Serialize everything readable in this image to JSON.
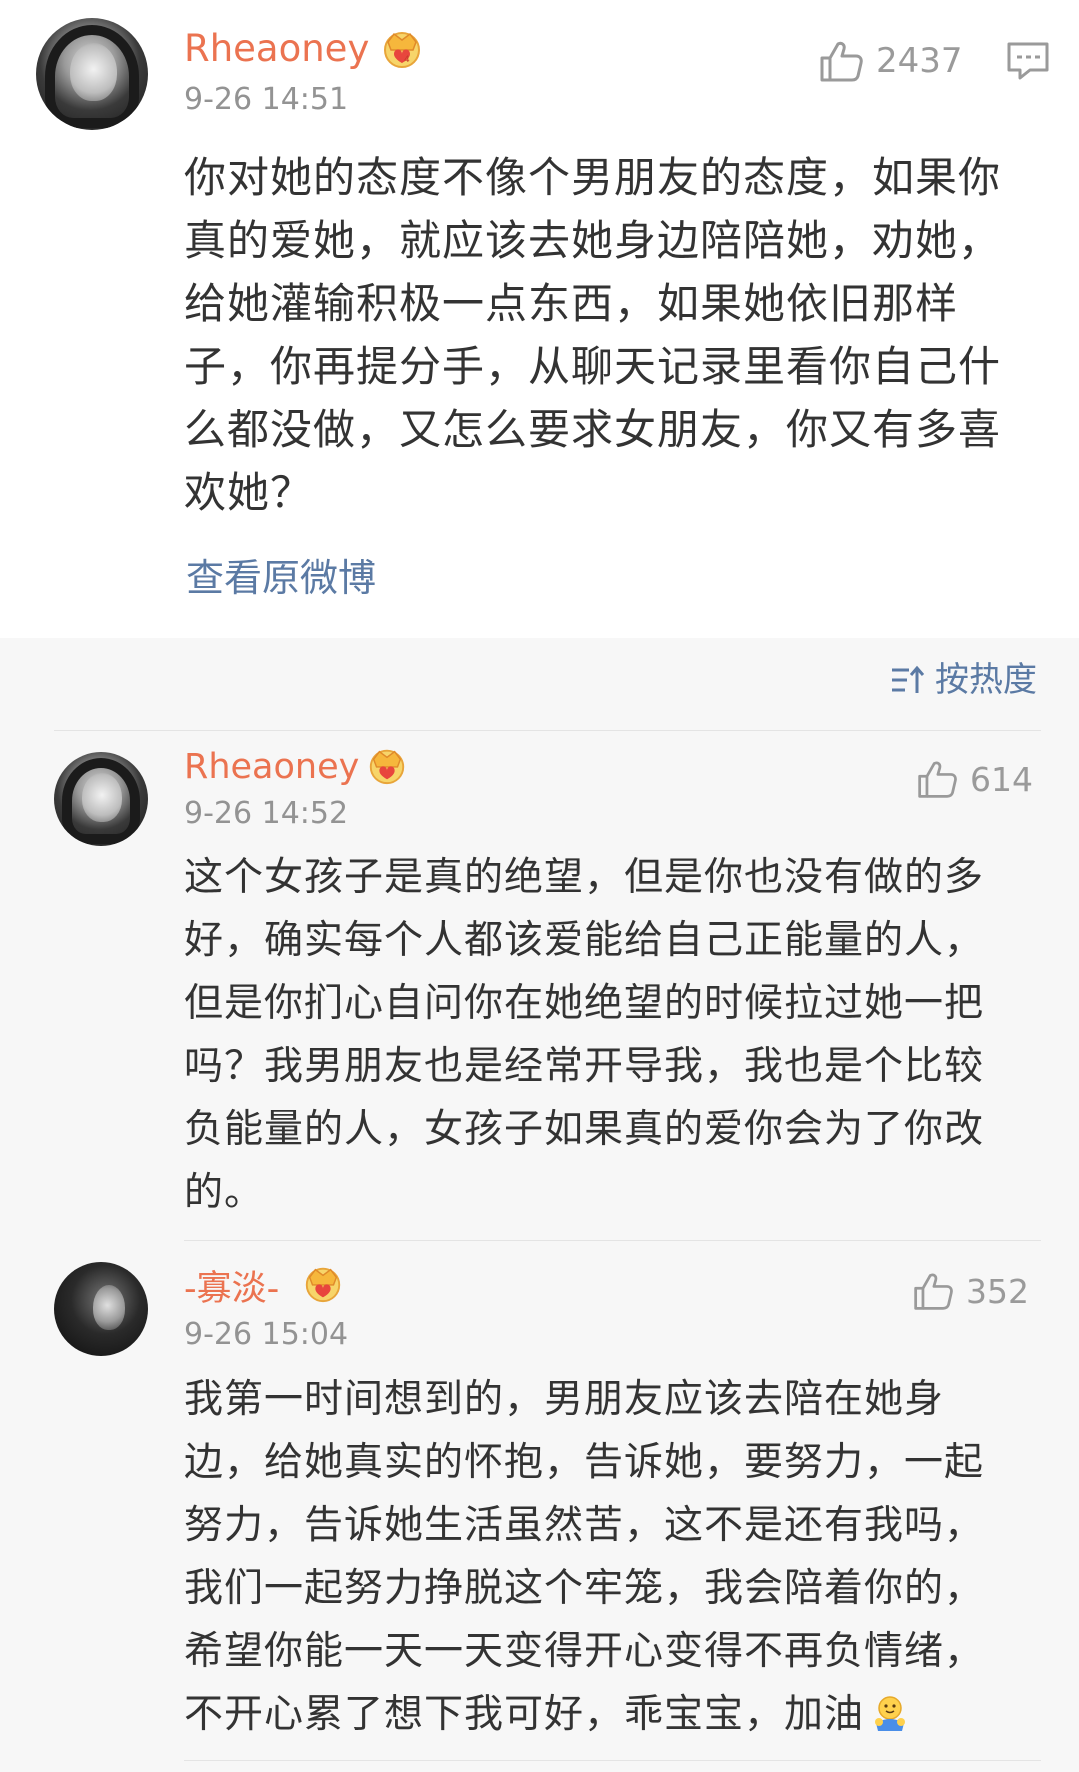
{
  "main_comment": {
    "username": "Rheaoney",
    "time": "9-26 14:51",
    "likes": "2437",
    "lines": [
      "你对她的态度不像个男朋友的态度，如果你",
      "真的爱她，就应该去她身边陪陪她，劝她，",
      "给她灌输积极一点东西，如果她依旧那样",
      "子，你再提分手，从聊天记录里看你自己什",
      "么都没做，又怎么要求女朋友，你又有多喜",
      "欢她？"
    ],
    "view_original": "查看原微博"
  },
  "sort": {
    "label": "按热度"
  },
  "replies": [
    {
      "username": "Rheaoney",
      "time": "9-26 14:52",
      "likes": "614",
      "lines": [
        "这个女孩子是真的绝望，但是你也没有做的多",
        "好，确实每个人都该爱能给自己正能量的人，",
        "但是你扪心自问你在她绝望的时候拉过她一把",
        "吗？我男朋友也是经常开导我，我也是个比较",
        "负能量的人，女孩子如果真的爱你会为了你改",
        "的。"
      ]
    },
    {
      "username": "-寡淡-",
      "time": "9-26 15:04",
      "likes": "352",
      "lines": [
        "我第一时间想到的，男朋友应该去陪在她身",
        "边，给她真实的怀抱，告诉她，要努力，一起",
        "努力，告诉她生活虽然苦，这不是还有我吗，",
        "我们一起努力挣脱这个牢笼，我会陪着你的，",
        "希望你能一天一天变得开心变得不再负情绪，",
        "不开心累了想下我可好，乖宝宝，加油"
      ]
    }
  ],
  "colors": {
    "username": "#eb7350",
    "link": "#5b7aa4",
    "time": "#939393",
    "text": "#333333"
  },
  "icons": [
    "thumbs-up-icon",
    "comment-icon",
    "crown-badge-icon",
    "sort-icon",
    "hug-emoji-icon"
  ]
}
